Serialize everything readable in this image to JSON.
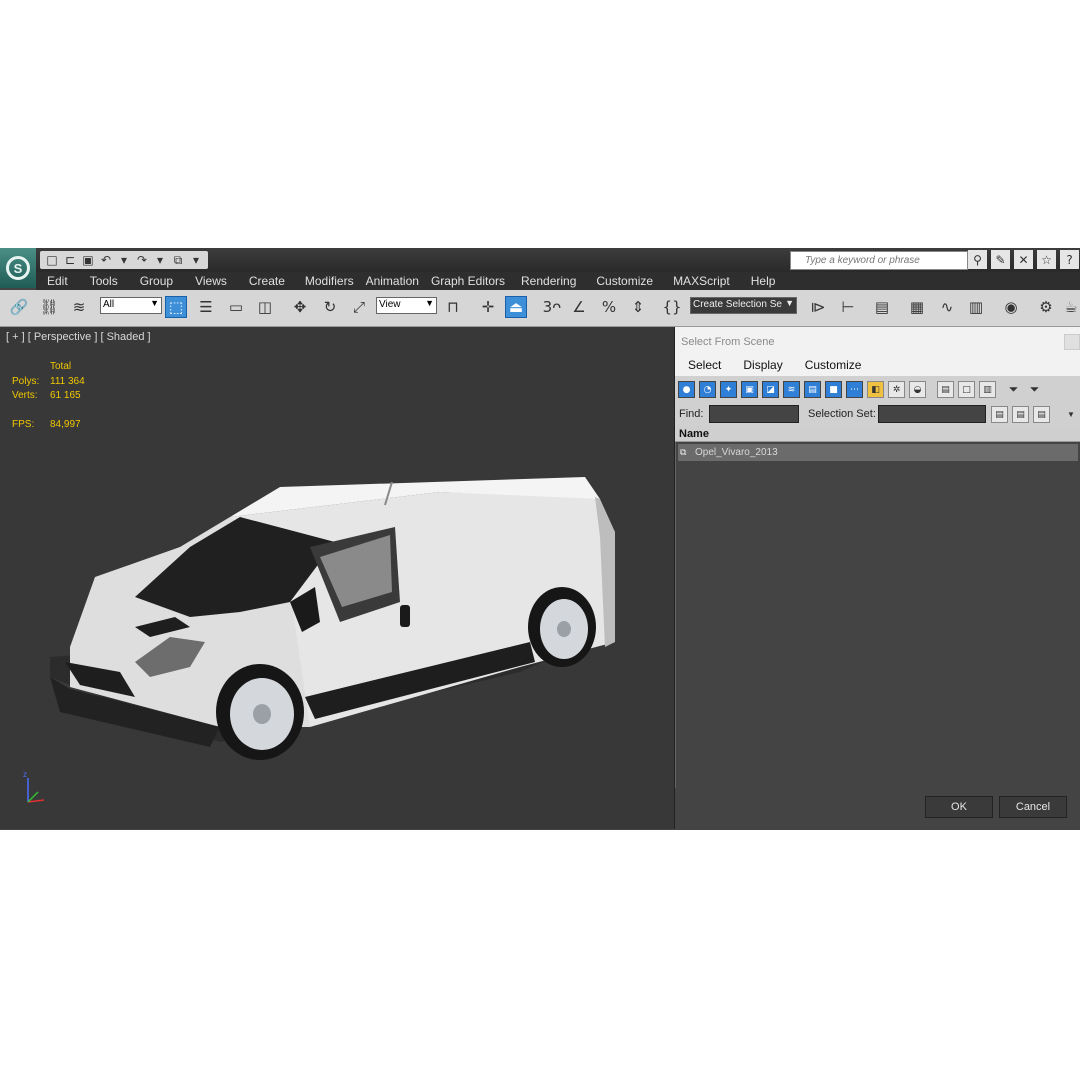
{
  "app": {
    "logo_letter": "S",
    "quick_access": [
      "new-icon",
      "open-icon",
      "save-icon",
      "undo-icon",
      "redo-icon",
      "project-icon"
    ],
    "search_placeholder": "Type a keyword or phrase"
  },
  "menu": [
    "Edit",
    "Tools",
    "Group",
    "Views",
    "Create",
    "Modifiers",
    "Animation",
    "Graph Editors",
    "Rendering",
    "Customize",
    "MAXScript",
    "Help"
  ],
  "toolbar": {
    "selection_filter": "All",
    "reference_coord": "View",
    "named_selection_set": "Create Selection Se"
  },
  "viewport": {
    "label": "[ + ] [ Perspective ] [ Shaded ]",
    "stats_header": "Total",
    "polys_label": "Polys:",
    "polys_value": "111 364",
    "verts_label": "Verts:",
    "verts_value": "61 165",
    "fps_label": "FPS:",
    "fps_value": "84,997",
    "axis_z": "z"
  },
  "dialog": {
    "title": "Select From Scene",
    "menu": [
      "Select",
      "Display",
      "Customize"
    ],
    "find_label": "Find:",
    "selection_set_label": "Selection Set:",
    "column_name": "Name",
    "objects": [
      {
        "name": "Opel_Vivaro_2013"
      }
    ],
    "ok_label": "OK",
    "cancel_label": "Cancel"
  },
  "colors": {
    "accent": "#3d8fd8",
    "stats_text": "#f2c800",
    "viewport_bg": "#383838"
  }
}
